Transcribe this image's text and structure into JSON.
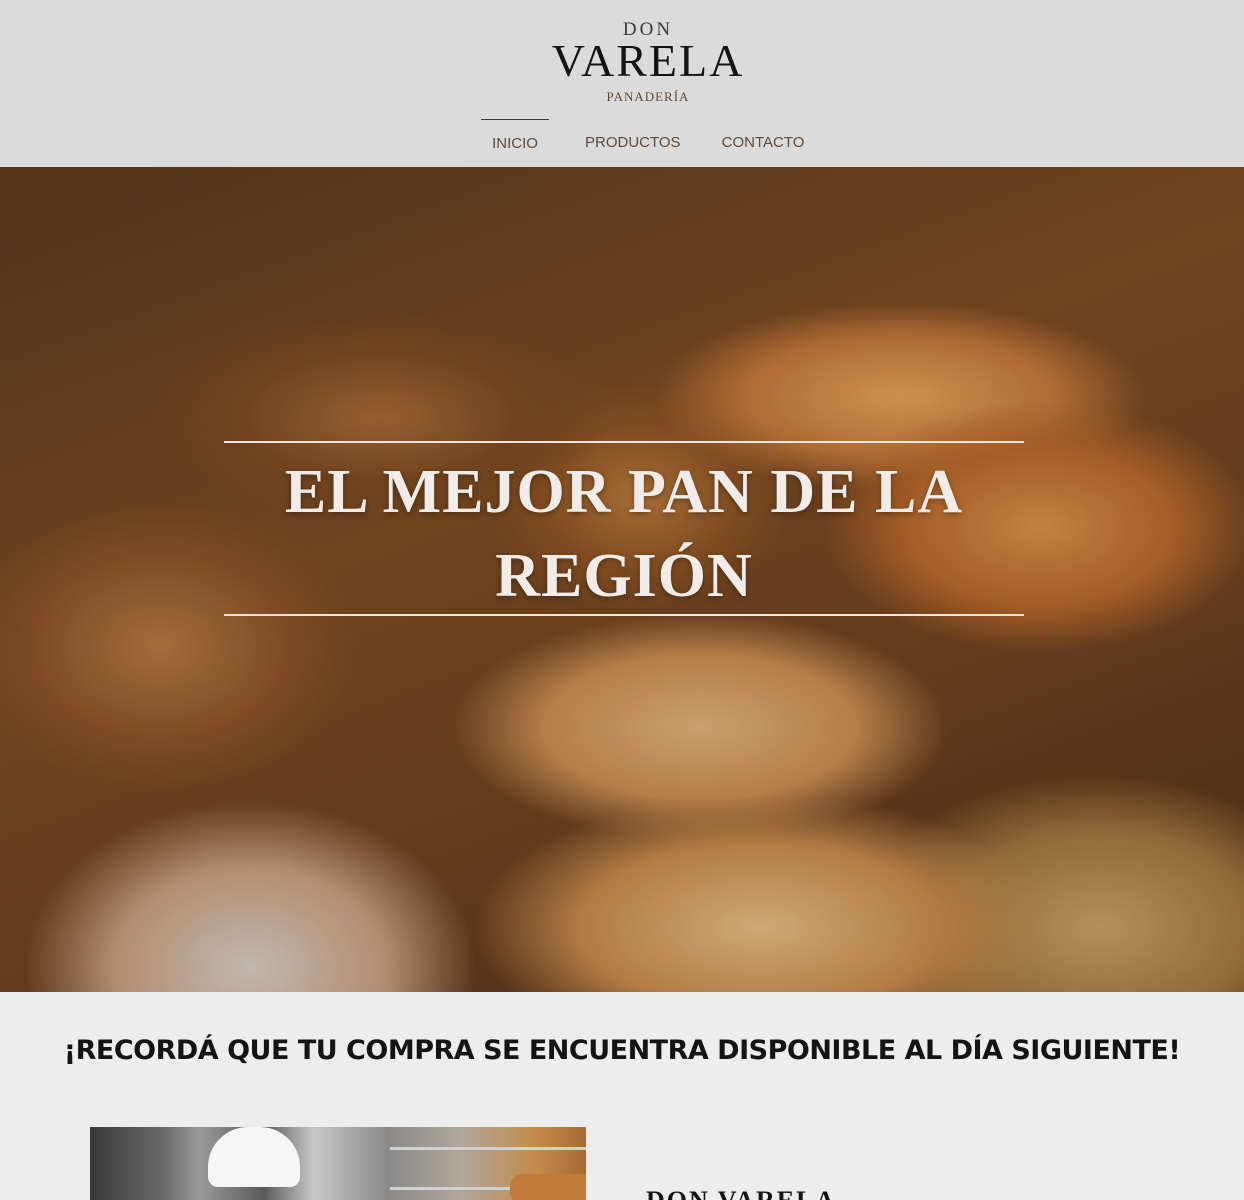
{
  "header": {
    "logo_top": "DON",
    "logo_main": "VARELA",
    "logo_sub": "PANADERÍA"
  },
  "nav": {
    "items": [
      {
        "label": "INICIO",
        "active": true
      },
      {
        "label": "PRODUCTOS",
        "active": false
      },
      {
        "label": "CONTACTO",
        "active": false
      }
    ]
  },
  "hero": {
    "title": "EL MEJOR PAN DE LA REGIÓN"
  },
  "notice": {
    "text": "¡RECORDÁ QUE TU COMPRA SE ENCUENTRA DISPONIBLE AL DÍA SIGUIENTE!"
  },
  "about": {
    "title": "DON VARELA"
  },
  "colors": {
    "header_bg": "#dcdbdb",
    "page_bg": "#eeeded",
    "nav_text": "#5a4a3f",
    "hero_text": "#f1ece8"
  }
}
